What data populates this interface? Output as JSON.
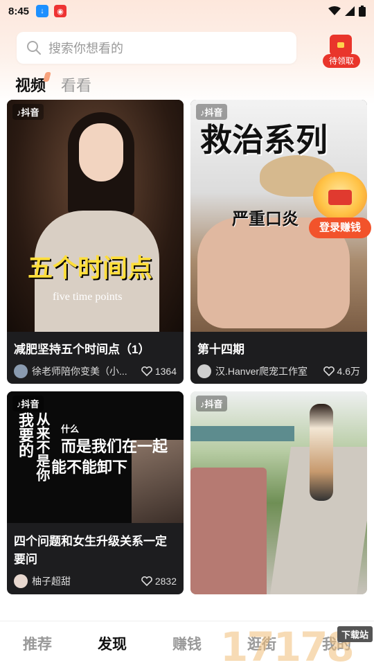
{
  "status_bar": {
    "time": "8:45"
  },
  "search": {
    "placeholder": "搜索你想看的"
  },
  "redpacket": {
    "label": "待领取"
  },
  "tabs": [
    {
      "label": "视频",
      "active": true
    },
    {
      "label": "看看",
      "active": false
    }
  ],
  "cards": [
    {
      "badge": "抖音",
      "overlay_title": "五个时间点",
      "overlay_sub": "five time points",
      "title": "减肥坚持五个时间点（1）",
      "author": "徐老师陪你变美（小...",
      "likes": "1364"
    },
    {
      "badge": "抖音",
      "overlay_title": "救治系列",
      "overlay_sub": "严重口炎",
      "title": "第十四期",
      "author": "汉.Hanver爬宠工作室",
      "likes": "4.6万"
    },
    {
      "badge": "抖音",
      "overlay_line1": "我要的",
      "overlay_line2": "从来不是你",
      "overlay_line3": "什么",
      "overlay_line4": "而是我们在一起",
      "overlay_line5": "能不能卸下",
      "title": "四个问题和女生升级关系一定要问",
      "author": "柚子超甜",
      "likes": "2832"
    },
    {
      "badge": "抖音"
    }
  ],
  "float_promo": {
    "label": "登录赚钱"
  },
  "bottom_nav": [
    {
      "label": "推荐",
      "active": false
    },
    {
      "label": "发现",
      "active": true
    },
    {
      "label": "赚钱",
      "active": false
    },
    {
      "label": "逛街",
      "active": false
    },
    {
      "label": "我的",
      "active": false
    }
  ],
  "watermark": {
    "digits": "17178",
    "tag": "下载站"
  },
  "colors": {
    "accent": "#e9352b",
    "promo": "#f2532b",
    "card_bg": "#1d1d1f"
  }
}
